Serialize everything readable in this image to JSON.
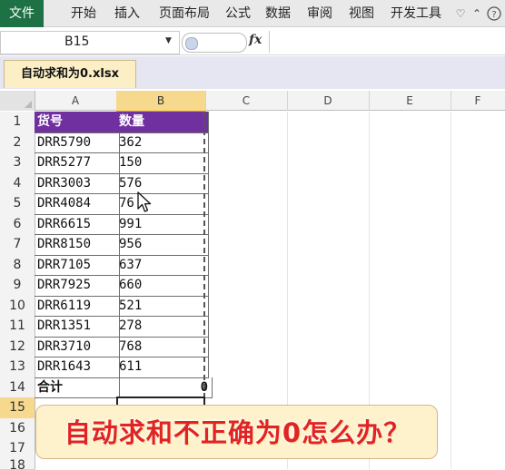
{
  "ribbon": {
    "tabs": [
      "文件",
      "开始",
      "插入",
      "页面布局",
      "公式",
      "数据",
      "审阅",
      "视图",
      "开发工具"
    ],
    "icons": [
      "heart-outline-icon",
      "minimize-ribbon-icon",
      "help-icon"
    ]
  },
  "formula_bar": {
    "name_box": "B15",
    "fx_label": "fx",
    "value": ""
  },
  "workbook": {
    "tab_label": "自动求和为0.xlsx"
  },
  "sheet": {
    "columns": [
      "A",
      "B",
      "C",
      "D",
      "E",
      "F"
    ],
    "selected_column": "B",
    "rows": [
      "1",
      "2",
      "3",
      "4",
      "5",
      "6",
      "7",
      "8",
      "9",
      "10",
      "11",
      "12",
      "13",
      "14",
      "15",
      "16",
      "17",
      "18"
    ],
    "selected_row": "15",
    "header": {
      "a": "货号",
      "b": "数量"
    },
    "data": [
      {
        "a": "DRR5790",
        "b": "362"
      },
      {
        "a": "DRR5277",
        "b": "150"
      },
      {
        "a": "DRR3003",
        "b": "576"
      },
      {
        "a": "DRR4084",
        "b": "76"
      },
      {
        "a": "DRR6615",
        "b": "991"
      },
      {
        "a": "DRR8150",
        "b": "956"
      },
      {
        "a": "DRR7105",
        "b": "637"
      },
      {
        "a": "DRR7925",
        "b": "660"
      },
      {
        "a": "DRR6119",
        "b": "521"
      },
      {
        "a": "DRR1351",
        "b": "278"
      },
      {
        "a": "DRR3710",
        "b": "768"
      },
      {
        "a": "DRR1643",
        "b": "611"
      }
    ],
    "total": {
      "label": "合计",
      "value": "0"
    }
  },
  "banner": {
    "text": "自动求和不正确为0怎么办？"
  },
  "colors": {
    "file_tab": "#1e7145",
    "header_fill": "#7030a0",
    "selection": "#f7d98d",
    "banner_text": "#e02424"
  }
}
